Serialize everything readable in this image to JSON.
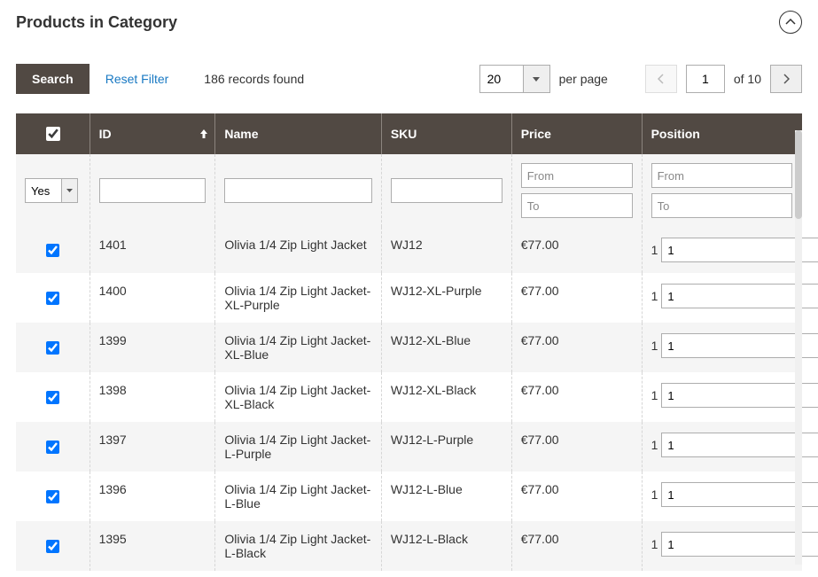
{
  "section_title": "Products in Category",
  "toolbar": {
    "search_label": "Search",
    "reset_filter_label": "Reset Filter",
    "records_found": "186 records found",
    "per_page_value": "20",
    "per_page_label": "per page",
    "current_page": "1",
    "of_pages": "of 10"
  },
  "headers": {
    "id": "ID",
    "name": "Name",
    "sku": "SKU",
    "price": "Price",
    "position": "Position"
  },
  "filters": {
    "select_value": "Yes",
    "from_placeholder": "From",
    "to_placeholder": "To"
  },
  "rows": [
    {
      "id": "1401",
      "name": "Olivia 1/4 Zip Light Jacket",
      "sku": "WJ12",
      "price": "€77.00",
      "position_prefix": "1",
      "position_value": "1"
    },
    {
      "id": "1400",
      "name": "Olivia 1/4 Zip Light Jacket-XL-Purple",
      "sku": "WJ12-XL-Purple",
      "price": "€77.00",
      "position_prefix": "1",
      "position_value": "1"
    },
    {
      "id": "1399",
      "name": "Olivia 1/4 Zip Light Jacket-XL-Blue",
      "sku": "WJ12-XL-Blue",
      "price": "€77.00",
      "position_prefix": "1",
      "position_value": "1"
    },
    {
      "id": "1398",
      "name": "Olivia 1/4 Zip Light Jacket-XL-Black",
      "sku": "WJ12-XL-Black",
      "price": "€77.00",
      "position_prefix": "1",
      "position_value": "1"
    },
    {
      "id": "1397",
      "name": "Olivia 1/4 Zip Light Jacket-L-Purple",
      "sku": "WJ12-L-Purple",
      "price": "€77.00",
      "position_prefix": "1",
      "position_value": "1"
    },
    {
      "id": "1396",
      "name": "Olivia 1/4 Zip Light Jacket-L-Blue",
      "sku": "WJ12-L-Blue",
      "price": "€77.00",
      "position_prefix": "1",
      "position_value": "1"
    },
    {
      "id": "1395",
      "name": "Olivia 1/4 Zip Light Jacket-L-Black",
      "sku": "WJ12-L-Black",
      "price": "€77.00",
      "position_prefix": "1",
      "position_value": "1"
    }
  ]
}
